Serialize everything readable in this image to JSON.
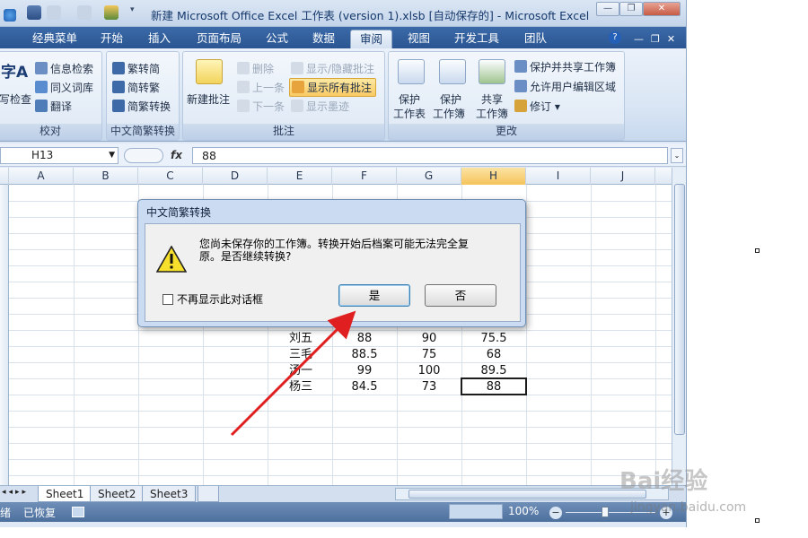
{
  "window": {
    "title": "新建 Microsoft Office Excel 工作表 (version 1).xlsb [自动保存的] - Microsoft Excel",
    "min": "—",
    "restore": "❐",
    "close": "✕"
  },
  "tabs": [
    "经典菜单",
    "开始",
    "插入",
    "页面布局",
    "公式",
    "数据",
    "审阅",
    "视图",
    "开发工具",
    "团队"
  ],
  "active_tab": "审阅",
  "ribbon": {
    "proofing": {
      "label": "校对",
      "big_partial": "字A",
      "spell_partial": "写检查",
      "research": "信息检索",
      "thesaurus": "同义词库",
      "translate": "翻译"
    },
    "chinese": {
      "label": "中文简繁转换",
      "to_simplified": "繁转简",
      "to_traditional": "简转繁",
      "convert": "简繁转换"
    },
    "comments": {
      "label": "批注",
      "new": "新建批注",
      "delete": "删除",
      "previous": "上一条",
      "next": "下一条",
      "show_hide": "显示/隐藏批注",
      "show_all": "显示所有批注",
      "show_ink": "显示墨迹"
    },
    "changes": {
      "label": "更改",
      "protect_sheet_1": "保护",
      "protect_sheet_2": "工作表",
      "protect_wb_1": "保护",
      "protect_wb_2": "工作簿",
      "share_1": "共享",
      "share_2": "工作簿",
      "protect_share": "保护并共享工作簿",
      "allow_edit": "允许用户编辑区域",
      "track": "修订"
    }
  },
  "formula_bar": {
    "name_box": "H13",
    "fx": "fx",
    "value": "88"
  },
  "columns": [
    "A",
    "B",
    "C",
    "D",
    "E",
    "F",
    "G",
    "H",
    "I",
    "J"
  ],
  "selected_column": "H",
  "table_rows": [
    {
      "name": "刘五",
      "f": "88",
      "g": "90",
      "h": "75.5"
    },
    {
      "name": "三毛",
      "f": "88.5",
      "g": "75",
      "h": "68"
    },
    {
      "name": "汤一",
      "f": "99",
      "g": "100",
      "h": "89.5"
    },
    {
      "name": "杨三",
      "f": "84.5",
      "g": "73",
      "h": "88"
    }
  ],
  "sheets": [
    "Sheet1",
    "Sheet2",
    "Sheet3"
  ],
  "active_sheet": "Sheet1",
  "status": {
    "ready_partial": "绪",
    "recovered": "已恢复",
    "zoom": "100%"
  },
  "dialog": {
    "title": "中文简繁转换",
    "message": "您尚未保存你的工作簿。转换开始后档案可能无法完全复原。是否继续转换?",
    "checkbox": "不再显示此对话框",
    "yes": "是",
    "no": "否"
  },
  "watermark": {
    "brand": "Bai经验",
    "url": "jingyan.baidu.com"
  },
  "colors": {
    "accent_tab": "#2a5592",
    "arrow": "#e02020",
    "selection": "#f6c45c"
  }
}
